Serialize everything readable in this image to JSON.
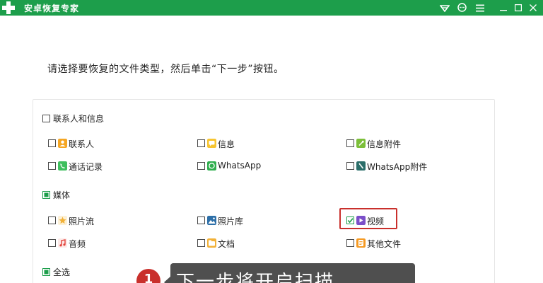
{
  "app": {
    "title": "安卓恢复专家"
  },
  "titlebar_icons": [
    "wifi-icon",
    "chat-icon",
    "menu-icon",
    "minimize-icon",
    "maximize-icon",
    "close-icon"
  ],
  "instruction": "请选择要恢复的文件类型，然后单击“下一步”按钮。",
  "groups": {
    "contacts": {
      "label": "联系人和信息",
      "checked": false,
      "items": [
        {
          "label": "联系人",
          "checked": false,
          "icon": "contact-icon",
          "color": "#f5a623"
        },
        {
          "label": "信息",
          "checked": false,
          "icon": "message-icon",
          "color": "#f7c531"
        },
        {
          "label": "信息附件",
          "checked": false,
          "icon": "attachment-icon",
          "color": "#7cbf3a"
        },
        {
          "label": "通话记录",
          "checked": false,
          "icon": "phone-icon",
          "color": "#3fbf5e"
        },
        {
          "label": "WhatsApp",
          "checked": false,
          "icon": "whatsapp-icon",
          "color": "#2fae4e"
        },
        {
          "label": "WhatsApp附件",
          "checked": false,
          "icon": "whatsapp-attachment-icon",
          "color": "#2b6e6a"
        }
      ]
    },
    "media": {
      "label": "媒体",
      "checked": true,
      "items": [
        {
          "label": "照片流",
          "checked": false,
          "icon": "photo-stream-icon",
          "color": "#f2b138"
        },
        {
          "label": "照片库",
          "checked": false,
          "icon": "photo-library-icon",
          "color": "#2d6fa8"
        },
        {
          "label": "视频",
          "checked": true,
          "icon": "video-icon",
          "color": "#7b4fc9"
        },
        {
          "label": "音频",
          "checked": false,
          "icon": "audio-icon",
          "color": "#e2423b"
        },
        {
          "label": "文档",
          "checked": false,
          "icon": "document-icon",
          "color": "#f2b138"
        },
        {
          "label": "其他文件",
          "checked": false,
          "icon": "other-files-icon",
          "color": "#f59a23"
        }
      ]
    }
  },
  "select_all": {
    "label": "全选",
    "checked": true
  },
  "callout": {
    "step": "1",
    "text": "下一步将开启扫描"
  },
  "colors": {
    "brand": "#1d9e4b",
    "highlight": "#c9302c",
    "tooltip_bg": "#4f4f4f"
  }
}
